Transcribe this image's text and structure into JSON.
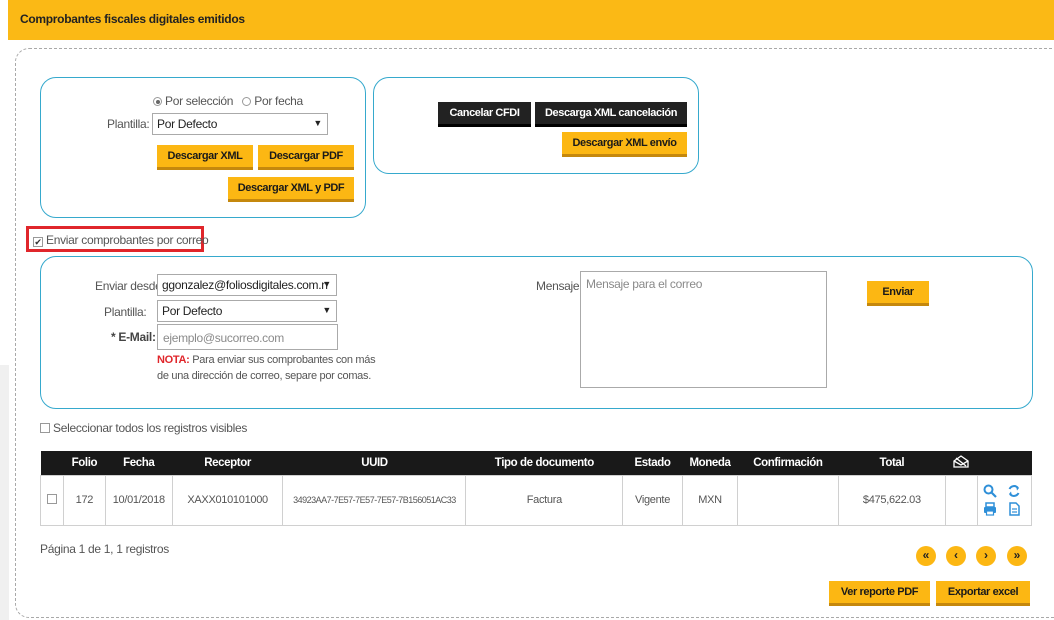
{
  "header": {
    "title": "Comprobantes fiscales digitales emitidos"
  },
  "download_panel": {
    "radio_selection": "Por selección",
    "radio_date": "Por fecha",
    "template_label": "Plantilla:",
    "template_value": "Por Defecto",
    "btn_xml": "Descargar XML",
    "btn_pdf": "Descargar PDF",
    "btn_xml_pdf": "Descargar XML y PDF"
  },
  "cancel_panel": {
    "btn_cancel": "Cancelar CFDI",
    "btn_cancel_xml": "Descarga XML cancelación",
    "btn_send_xml": "Descargar XML envío"
  },
  "email_toggle": {
    "label": "Enviar comprobantes por correo",
    "checked": true
  },
  "email_panel": {
    "from_label": "Enviar desde:",
    "from_value": "ggonzalez@foliosdigitales.com.n",
    "template_label": "Plantilla:",
    "template_value": "Por Defecto",
    "email_label": "* E-Mail:",
    "email_placeholder": "ejemplo@sucorreo.com",
    "note_bold": "NOTA:",
    "note_text": " Para enviar sus comprobantes con más",
    "note_text2": "de una dirección de correo, separe por comas.",
    "message_label": "Mensaje:",
    "message_placeholder": "Mensaje para el correo",
    "send_button": "Enviar"
  },
  "select_all": {
    "label": "Seleccionar todos los registros visibles"
  },
  "table": {
    "columns": [
      "Folio",
      "Fecha",
      "Receptor",
      "UUID",
      "Tipo de documento",
      "Estado",
      "Moneda",
      "Confirmación",
      "Total"
    ],
    "rows": [
      {
        "folio": "172",
        "fecha": "10/01/2018",
        "receptor": "XAXX010101000",
        "uuid": "34923AA7-7E57-7E57-7E57-7B156051AC33",
        "tipo": "Factura",
        "estado": "Vigente",
        "moneda": "MXN",
        "confirmacion": "",
        "total": "$475,622.03"
      }
    ]
  },
  "pagination": {
    "text": "Página 1 de 1, 1 registros",
    "first": "«",
    "prev": "‹",
    "next": "›",
    "last": "»"
  },
  "footer": {
    "btn_pdf_report": "Ver reporte PDF",
    "btn_export_excel": "Exportar excel"
  },
  "colors": {
    "accent": "#fcb713",
    "panel_border": "#36a9cd",
    "header_bg": "#fbb915",
    "alert": "#e0262b"
  }
}
